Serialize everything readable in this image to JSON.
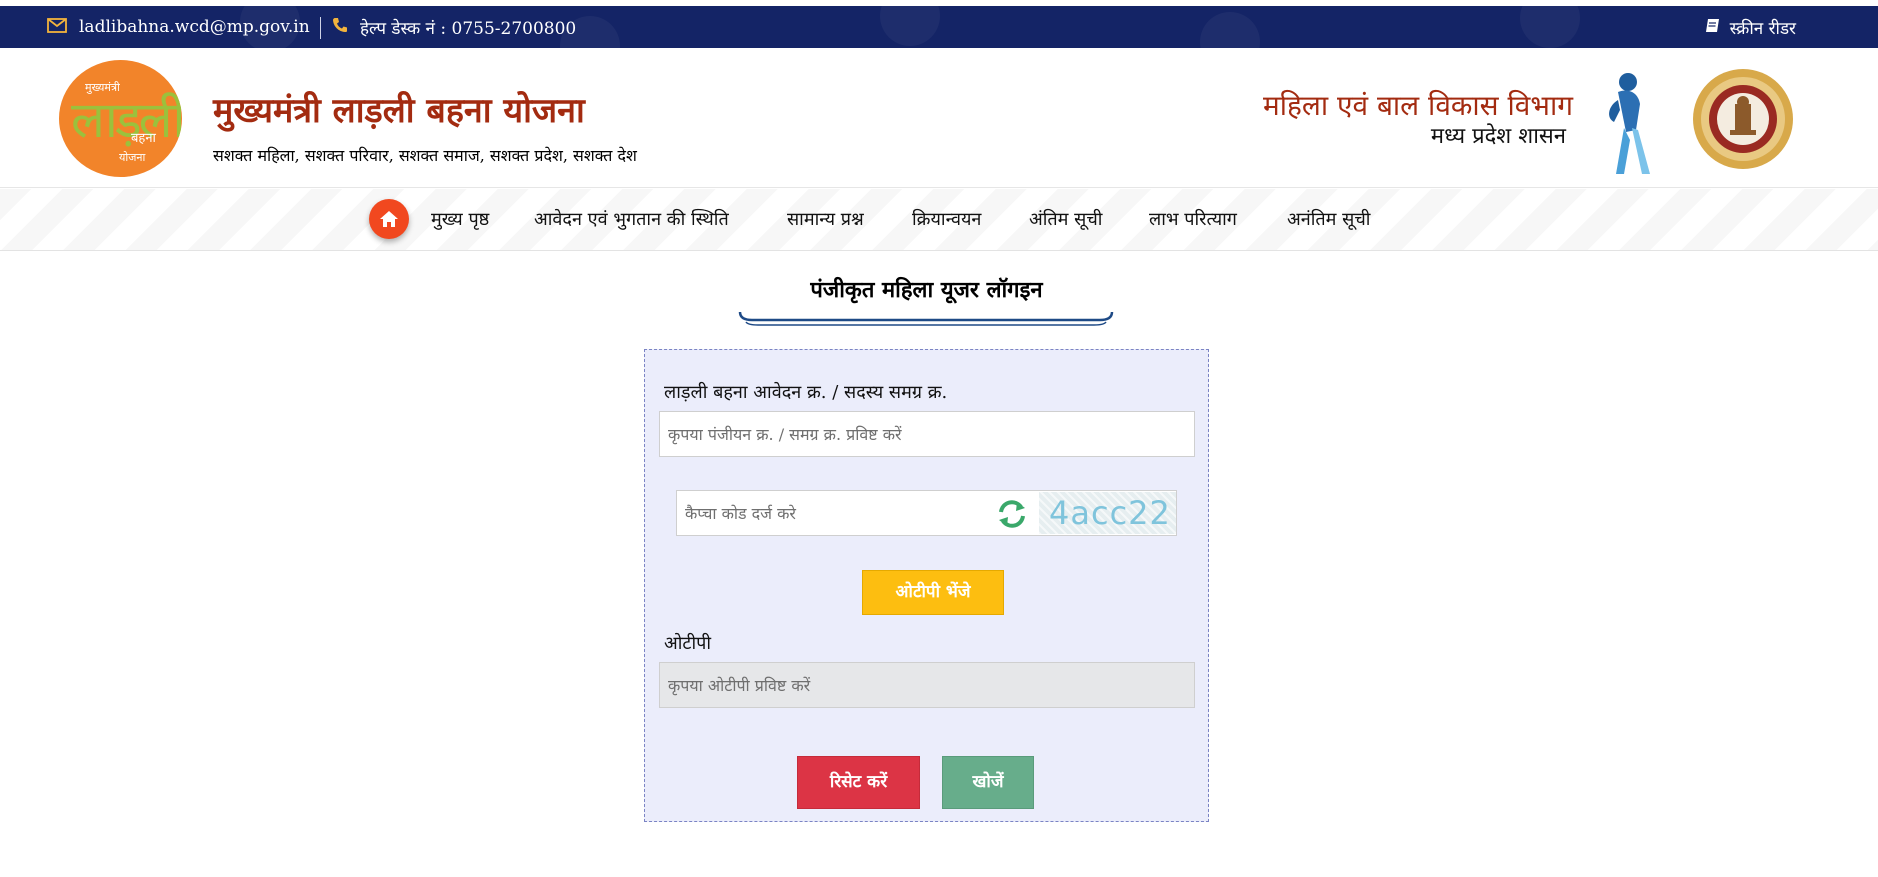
{
  "topbar": {
    "email": "ladlibahna.wcd@mp.gov.in",
    "helpdesk": "हेल्प डेस्क नं : 0755-2700800",
    "screen_reader": "स्क्रीन रीडर",
    "icons": {
      "email": "envelope-icon",
      "phone": "phone-icon",
      "reader": "book-icon"
    },
    "bg_color": "#142466",
    "icon_color": "#f2b33d"
  },
  "header": {
    "logo": {
      "line1": "मुख्यमंत्री",
      "line2": "लाड़ली",
      "line3": "बहना",
      "line4": "योजना"
    },
    "title": "मुख्यमंत्री लाड़ली बहना योजना",
    "tagline": "सशक्त महिला, सशक्त परिवार, सशक्त समाज, सशक्त प्रदेश, सशक्त देश",
    "department": "महिला एवं बाल विकास विभाग",
    "government": "मध्य प्रदेश शासन",
    "title_color": "#a32b10"
  },
  "nav": {
    "home_icon": "home-icon",
    "items": [
      {
        "label": "मुख्य पृष्ठ"
      },
      {
        "label": "आवेदन एवं भुगतान की स्थिति"
      },
      {
        "label": "सामान्य प्रश्न"
      },
      {
        "label": "क्रियान्वयन"
      },
      {
        "label": "अंतिम सूची"
      },
      {
        "label": "लाभ परित्याग"
      },
      {
        "label": "अनंतिम सूची"
      }
    ],
    "accent": "#f1481f"
  },
  "login": {
    "heading": "पंजीकृत महिला यूजर लॉगइन",
    "id_label": "लाड़ली बहना आवेदन क्र. / सदस्य समग्र क्र.",
    "id_placeholder": "कृपया पंजीयन क्र. / समग्र क्र. प्रविष्ट करें",
    "captcha_placeholder": "कैप्चा कोड दर्ज करे",
    "captcha_code": "4acc22",
    "send_otp": "ओटीपी भेंजे",
    "otp_label": "ओटीपी",
    "otp_placeholder": "कृपया ओटीपी प्रविष्ट करें",
    "reset": "रिसेट करें",
    "search": "खोजें",
    "colors": {
      "otp_button": "#fdbe10",
      "reset_button": "#dc3445",
      "search_button": "#67ad8b",
      "card_bg": "#ebedfb"
    }
  }
}
